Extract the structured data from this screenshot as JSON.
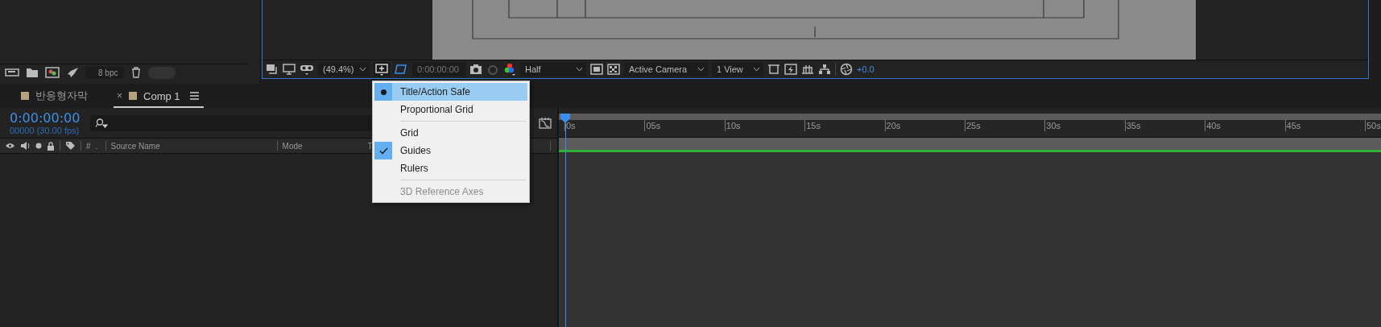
{
  "project_panel": {
    "bit_depth": "8 bpc"
  },
  "viewer": {
    "zoom": "(49.4%)",
    "timecode": "0:00:00:00",
    "resolution": "Half",
    "camera": "Active Camera",
    "views": "1 View",
    "exposure": "+0.0"
  },
  "guide_menu": {
    "groups": [
      {
        "items": [
          {
            "label": "Title/Action Safe",
            "kind": "radio",
            "checked": true,
            "selected": true,
            "disabled": false
          },
          {
            "label": "Proportional Grid",
            "checked": false,
            "selected": false,
            "disabled": false
          }
        ]
      },
      {
        "items": [
          {
            "label": "Grid",
            "checked": false,
            "selected": false,
            "disabled": false
          },
          {
            "label": "Guides",
            "kind": "check",
            "checked": true,
            "selected": false,
            "disabled": false
          },
          {
            "label": "Rulers",
            "checked": false,
            "selected": false,
            "disabled": false
          }
        ]
      },
      {
        "items": [
          {
            "label": "3D Reference Axes",
            "checked": false,
            "selected": false,
            "disabled": true
          }
        ]
      }
    ]
  },
  "tabs": [
    {
      "label": "반응형자막",
      "selected": false
    },
    {
      "label": "Comp 1",
      "selected": true,
      "close": "×"
    }
  ],
  "timeline": {
    "current_time": "0:00:00:00",
    "frame_info": "00000 (30.00 fps)",
    "columns": [
      "#",
      ".",
      "Source Name",
      "Mode",
      "T"
    ],
    "ruler": [
      "0s",
      "05s",
      "10s",
      "15s",
      "20s",
      "25s",
      "30s",
      "35s",
      "40s",
      "45s",
      "50s"
    ]
  }
}
